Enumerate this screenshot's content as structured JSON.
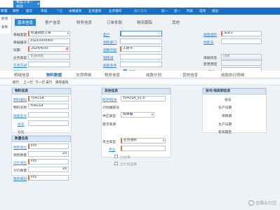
{
  "window_tab": {
    "title": "销售订单 - 修改",
    "close": "×"
  },
  "toolbar": {
    "items": [
      "新增",
      "保存",
      "提交",
      "审核",
      "下查",
      "关联查询",
      "业务查询",
      "业务操作",
      "报价查询",
      "前一",
      "后一",
      "列表",
      "选项",
      "退出"
    ],
    "disabled": [
      4,
      8
    ]
  },
  "side": {
    "new": "新增",
    "copy": "复制"
  },
  "tabs1": [
    "基本信息",
    "客户信息",
    "财务信息",
    "订单条款",
    "物流跟踪",
    "其他"
  ],
  "header_form": {
    "bill_type_label": "单据类型",
    "bill_type": "标准销售订单",
    "bill_no_label": "单据编号",
    "bill_no": "XSDD000069",
    "date_label": "日期",
    "date": "2024/4/30",
    "biz_type_label": "业务类型",
    "biz_type": "普通销售",
    "trade_mode_label": "交货方式",
    "trade_place_label": "交货地点",
    "customer_label": "客户",
    "sale_dept_label": "销售部门",
    "settle_currency_label": "结算币别",
    "settle_currency": "人民币",
    "sale_group_label": "销售组",
    "receive_label": "收款条件",
    "tax_included_label": "含税",
    "tax_included": "True",
    "sale_org_label": "销售组织",
    "sale_org": "车间1",
    "salesman_label": "销售员",
    "order_status_label": "单据状态",
    "order_status": "创建",
    "change_reason_label": "变更原因",
    "note_label": "备注"
  },
  "tabs2": [
    "明细信息",
    "物料数据",
    "交货明细",
    "税务信息",
    "收款计划",
    "其他信息",
    "收款执行明细"
  ],
  "tabs2_active": 1,
  "subbar": [
    "新行",
    "上一行",
    "下一行",
    "末行",
    "库存查询"
  ],
  "material": {
    "section": "物料信息",
    "code_label": "物料编码",
    "code": "Y0421A",
    "name_label": "物料名称",
    "name": "Y0421A",
    "spec_label": "规格型号",
    "lot_label": "批号",
    "aux_label": "仓位"
  },
  "attr": {
    "section": "其他信息",
    "bom_label": "BOM版本",
    "bom": "Y0421A_V1.0",
    "plan_label": "计划跟踪号",
    "supply_label": "供应类型",
    "supply": "按单编",
    "demand_label": "需求来源",
    "owner_type_label": "货主类型",
    "owner_type": "业务组织",
    "owner_label": "货主",
    "outbound_label": "已出库",
    "closed_label": "已计划运算"
  },
  "qty": {
    "section": "数量信息",
    "sale_unit_label": "销售单位",
    "sale_unit": "Pcs",
    "sale_qty_label": "销售数量",
    "sale_qty": "20",
    "price_unit_label": "计价单位",
    "price_unit": "Pcs",
    "price_qty_label": "计价数量",
    "price_qty": "20",
    "stock_unit_label": "库存单位",
    "stock_unit": "Pcs"
  },
  "lot": {
    "section": "批号/保质期信息",
    "lot_label": "批号",
    "produce_label": "生产日期",
    "shelf_label": "保质期",
    "prod_label": "生产日期",
    "expire_label": "有效期至"
  },
  "watermark": "金蝶云社区"
}
